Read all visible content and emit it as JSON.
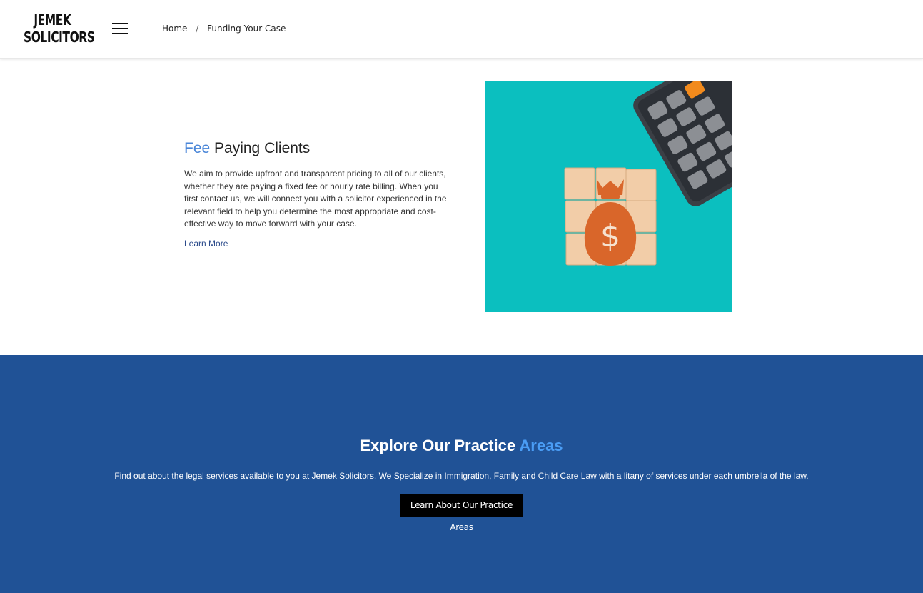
{
  "header": {
    "logo_line1": "JEMEK",
    "logo_line2": "SOLICITORS",
    "breadcrumb": {
      "home": "Home",
      "separator": "/",
      "current": "Funding Your Case"
    }
  },
  "fee_section": {
    "heading_accent": "Fee",
    "heading_rest": " Paying Clients",
    "body": "We aim to provide upfront and transparent pricing to all of our clients, whether they are paying a fixed fee or hourly rate billing. When you first contact us, we will connect you with a solicitor experienced in the relevant field to help you determine the most appropriate and cost-effective way to move forward with your case.",
    "link": "Learn More",
    "image_symbol": "$"
  },
  "practice_areas": {
    "heading_main": "Explore Our Practice ",
    "heading_accent": "Areas",
    "text": "Find out about the legal services available to you at Jemek Solicitors. We Specialize in Immigration, Family and Child Care Law with a litany of services under each umbrella of the law.",
    "button": "Learn About Our Practice Areas"
  },
  "colors": {
    "accent": "#4a86d8",
    "band": "#205296",
    "photo_bg": "#0bbfbf"
  }
}
